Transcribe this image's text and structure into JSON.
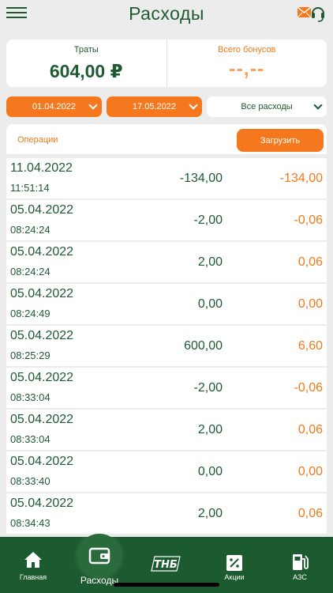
{
  "header": {
    "title": "Расходы",
    "menu_icon": "hamburger-icon",
    "support_icon": "mail-headset-icon"
  },
  "summary": {
    "spent_label": "Траты",
    "spent_value": "604,00 ₽",
    "bonus_label": "Всего бонусов",
    "bonus_value": "--,--"
  },
  "filters": {
    "date_from": "01.04.2022",
    "date_to": "17.05.2022",
    "type": "Все расходы"
  },
  "operations": {
    "label": "Операции",
    "load_button": "Загрузить"
  },
  "rows": [
    {
      "date": "11.04.2022",
      "time": "11:51:14",
      "amount": "-134,00",
      "bonus": "-134,00"
    },
    {
      "date": "05.04.2022",
      "time": "08:24:24",
      "amount": "-2,00",
      "bonus": "-0,06"
    },
    {
      "date": "05.04.2022",
      "time": "08:24:24",
      "amount": "2,00",
      "bonus": "0,06"
    },
    {
      "date": "05.04.2022",
      "time": "08:24:49",
      "amount": "0,00",
      "bonus": "0,00"
    },
    {
      "date": "05.04.2022",
      "time": "08:25:29",
      "amount": "600,00",
      "bonus": "6,60"
    },
    {
      "date": "05.04.2022",
      "time": "08:33:04",
      "amount": "-2,00",
      "bonus": "-0,06"
    },
    {
      "date": "05.04.2022",
      "time": "08:33:04",
      "amount": "2,00",
      "bonus": "0,06"
    },
    {
      "date": "05.04.2022",
      "time": "08:33:40",
      "amount": "0,00",
      "bonus": "0,00"
    },
    {
      "date": "05.04.2022",
      "time": "08:34:43",
      "amount": "2,00",
      "bonus": "0,06"
    }
  ],
  "tabbar": {
    "items": [
      {
        "label": "Главная",
        "icon": "home-icon"
      },
      {
        "label": "Расходы",
        "icon": "wallet-icon",
        "active": true
      },
      {
        "label": "",
        "icon": "tnb-logo-icon",
        "logo_text": "ТНБ"
      },
      {
        "label": "Акции",
        "icon": "percent-icon"
      },
      {
        "label": "АЗС",
        "icon": "fuel-pump-icon"
      }
    ]
  },
  "colors": {
    "green": "#1f5a33",
    "orange": "#f5781f",
    "tabbar": "#1c5a2f",
    "background": "#ececec"
  }
}
